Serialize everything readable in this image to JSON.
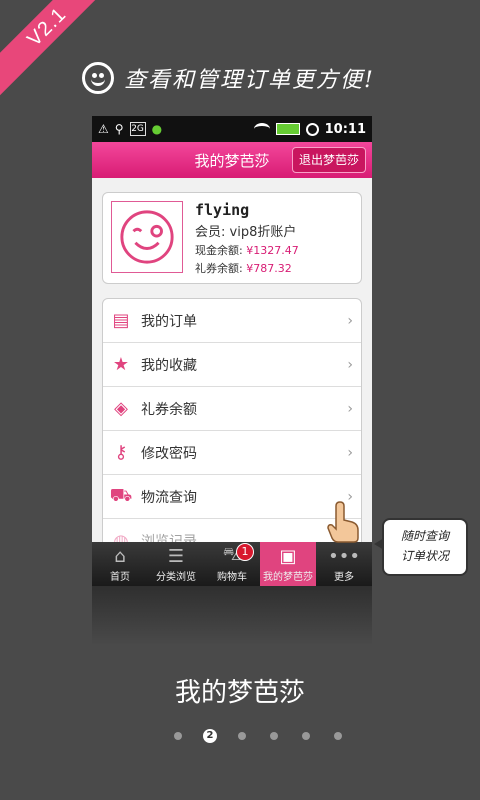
{
  "version_ribbon": "V2.1",
  "headline": "查看和管理订单更方便!",
  "statusbar": {
    "time": "10:11",
    "icon_text": "2G"
  },
  "titlebar": {
    "title": "我的梦芭莎",
    "logout_label": "退出梦芭莎"
  },
  "profile": {
    "name": "flying",
    "member": "会员: vip8折账户",
    "cash_label": "现金余额:",
    "cash_value": "¥1327.47",
    "coupon_label": "礼券余额:",
    "coupon_value": "¥787.32"
  },
  "menu": [
    {
      "label": "我的订单",
      "icon": "order-icon"
    },
    {
      "label": "我的收藏",
      "icon": "star-icon"
    },
    {
      "label": "礼券余额",
      "icon": "tag-icon"
    },
    {
      "label": "修改密码",
      "icon": "key-icon"
    },
    {
      "label": "物流查询",
      "icon": "truck-icon"
    },
    {
      "label": "浏览记录",
      "icon": "globe-icon"
    }
  ],
  "tabs": [
    {
      "label": "首页",
      "icon": "home-icon"
    },
    {
      "label": "分类浏览",
      "icon": "list-icon"
    },
    {
      "label": "购物车",
      "icon": "cart-icon",
      "badge": "1"
    },
    {
      "label": "我的梦芭莎",
      "icon": "contact-icon"
    },
    {
      "label": "更多",
      "icon": "more-icon"
    }
  ],
  "callout": {
    "line1": "随时查询",
    "line2": "订单状况"
  },
  "caption": "我的梦芭莎",
  "pager": {
    "current": "2"
  },
  "colors": {
    "accent": "#e0447f",
    "background": "#4a4a4a"
  }
}
